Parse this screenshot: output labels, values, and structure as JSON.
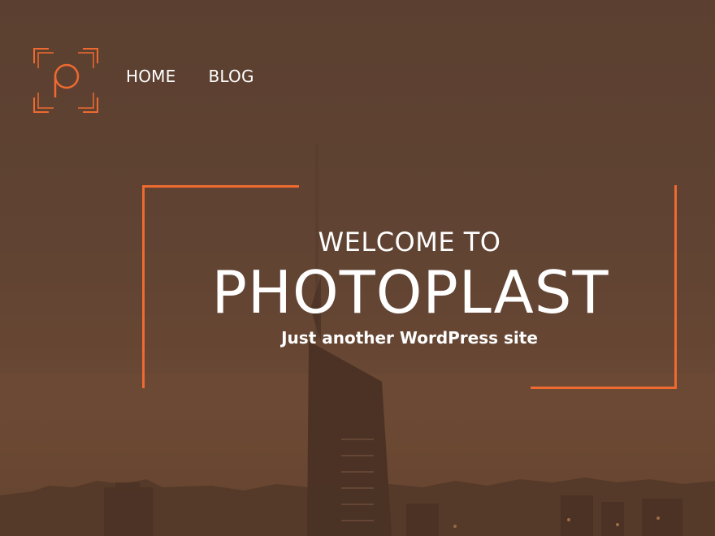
{
  "brand": {
    "logo_icon": "photoplast-p-viewfinder-icon",
    "accent_color": "#ee6a30",
    "overlay_color": "#5e4131"
  },
  "nav": {
    "items": [
      {
        "label": "HOME"
      },
      {
        "label": "BLOG"
      }
    ]
  },
  "hero": {
    "welcome": "WELCOME TO",
    "title": "PHOTOPLAST",
    "tagline": "Just another WordPress site",
    "background": "city-skyline-tower-photo"
  }
}
